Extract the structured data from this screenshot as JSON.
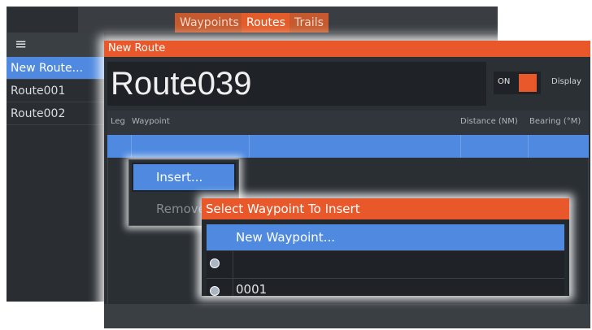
{
  "tabs": [
    "Waypoints",
    "Routes",
    "Trails"
  ],
  "sidebar": {
    "menu_icon": "hamburger-icon",
    "items": [
      "New Route...",
      "Route001",
      "Route002"
    ]
  },
  "route_dialog": {
    "title": "New Route",
    "route_name": "Route039",
    "toggle_label": "ON",
    "display_label": "Display",
    "columns": [
      "Leg",
      "Waypoint",
      "Distance (NM)",
      "Bearing (°M)"
    ]
  },
  "context_menu": {
    "items": [
      "Insert...",
      "Remove"
    ]
  },
  "waypoint_dialog": {
    "title": "Select Waypoint To Insert",
    "options": [
      "New Waypoint...",
      "",
      "0001"
    ],
    "icon": "waypoint-marker-icon"
  },
  "colors": {
    "accent_orange": "#e9582b",
    "selection_blue": "#4f8ae0",
    "panel_dark": "#2b3035"
  }
}
